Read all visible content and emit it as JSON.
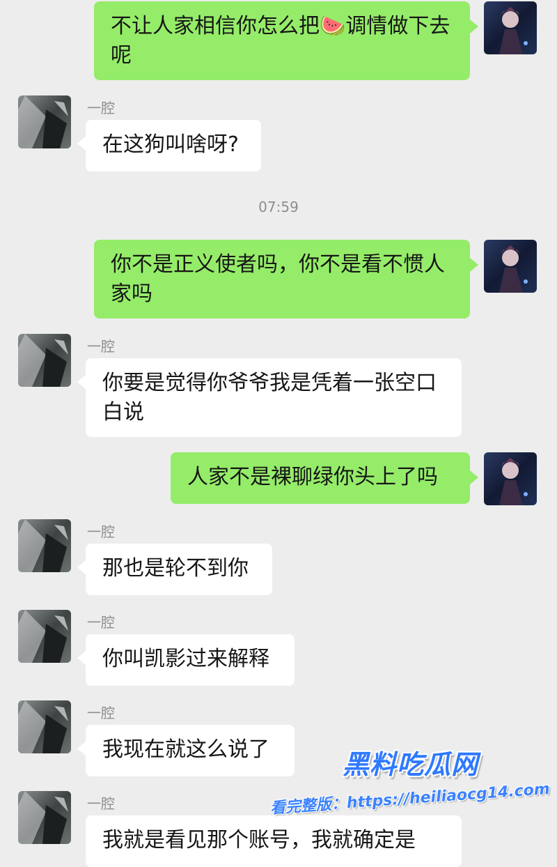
{
  "messages": [
    {
      "sender": "me",
      "text": "不让人家相信你怎么把🍉调情做下去呢"
    },
    {
      "sender": "other",
      "name": "一腔",
      "text": "在这狗叫啥呀?"
    },
    {
      "sender": "me",
      "text": "你不是正义使者吗，你不是看不惯人家吗"
    },
    {
      "sender": "other",
      "name": "一腔",
      "text": "你要是觉得你爷爷我是凭着一张空口白说"
    },
    {
      "sender": "me",
      "text": "人家不是裸聊绿你头上了吗"
    },
    {
      "sender": "other",
      "name": "一腔",
      "text": "那也是轮不到你"
    },
    {
      "sender": "other",
      "name": "一腔",
      "text": "你叫凯影过来解释"
    },
    {
      "sender": "other",
      "name": "一腔",
      "text": "我现在就这么说了"
    },
    {
      "sender": "other",
      "name": "一腔",
      "text": "我就是看见那个账号，我就确定是"
    }
  ],
  "timestamp": "07:59",
  "watermark": {
    "title": "黑料吃瓜网",
    "url_line": "看完整版：https://heiliaocg14.com"
  },
  "colors": {
    "background": "#ededed",
    "self_bubble": "#95ec69",
    "other_bubble": "#ffffff",
    "watermark_blue": "#2f79ff"
  }
}
